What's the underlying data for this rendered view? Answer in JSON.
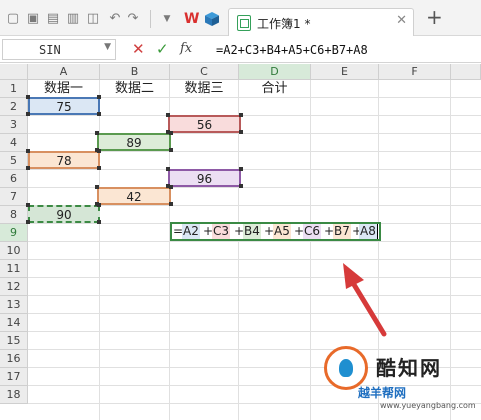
{
  "toolbar": {
    "tab_title": "工作簿1 *",
    "tab_close": "✕",
    "tab_add": "+"
  },
  "formula_bar": {
    "name_box": "SIN",
    "cancel": "✕",
    "confirm": "✓",
    "fx": "fx",
    "formula": "=A2+C3+B4+A5+C6+B7+A8"
  },
  "columns": [
    "A",
    "B",
    "C",
    "D",
    "E",
    "F"
  ],
  "rows": [
    "1",
    "2",
    "3",
    "4",
    "5",
    "6",
    "7",
    "8",
    "9",
    "10",
    "11",
    "12",
    "13",
    "14",
    "15",
    "16",
    "17",
    "18"
  ],
  "headers": {
    "a1": "数据一",
    "b1": "数据二",
    "c1": "数据三",
    "d1": "合计"
  },
  "values": {
    "a2": "75",
    "c3": "56",
    "b4": "89",
    "a5": "78",
    "c6": "96",
    "b7": "42",
    "a8": "90"
  },
  "edit_formula": {
    "eq": "=",
    "p1": "A2",
    "op1": "+",
    "p2": "C3",
    "op2": "+",
    "p3": "B4",
    "op3": "+",
    "p4": "A5",
    "op4": "+",
    "p5": "C6",
    "op5": "+",
    "p6": "B7",
    "op6": "+",
    "p7": "A8"
  },
  "watermark": {
    "brand": "酷知网",
    "sub": "越羊帮网",
    "url": "www.yueyangbang.com"
  },
  "colors": {
    "accent_green": "#3a8a44",
    "arrow_red": "#d63a3a",
    "wps_red": "#d9302f"
  }
}
